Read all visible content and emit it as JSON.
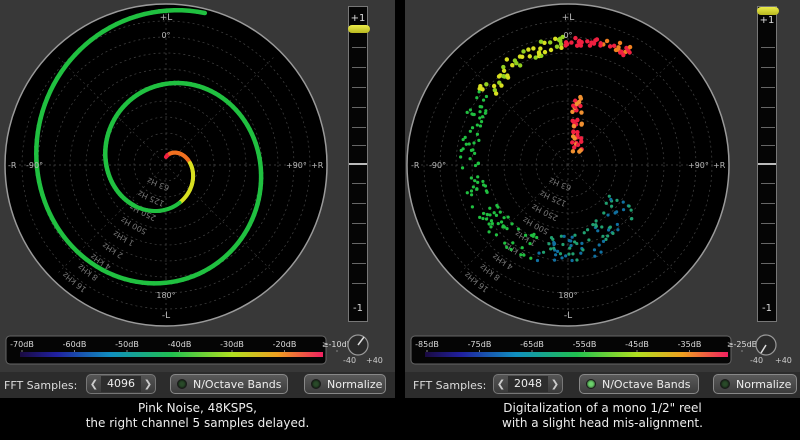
{
  "left": {
    "caption_line1": "Pink Noise, 48KSPS,",
    "caption_line2": "the right channel 5 samples delayed.",
    "scale_labels": [
      "-70dB",
      "-60dB",
      "-50dB",
      "-40dB",
      "-30dB",
      "-20dB",
      "≥-10dB"
    ],
    "fft_label": "FFT Samples:",
    "fft_value": "4096",
    "octave_label": "N/Octave Bands",
    "normalize_label": "Normalize",
    "octave_on": false,
    "normalize_on": false,
    "band_labels": [
      "63 Hz",
      "125 Hz",
      "250 Hz",
      "500 Hz",
      "1 kHz",
      "2 kHz",
      "4 kHz",
      "8 kHz",
      "16 kHz"
    ]
  },
  "right": {
    "caption_line1": "Digitalization of a mono 1/2\" reel",
    "caption_line2": "with a slight head mis-alignment.",
    "scale_labels": [
      "-85dB",
      "-75dB",
      "-65dB",
      "-55dB",
      "-45dB",
      "-35dB",
      "≥-25dB"
    ],
    "fft_label": "FFT Samples:",
    "fft_value": "2048",
    "octave_label": "N/Octave Bands",
    "normalize_label": "Normalize",
    "octave_on": true,
    "normalize_on": false,
    "band_labels": [
      "63 Hz",
      "125 Hz",
      "250 Hz",
      "500 Hz",
      "1 kHz",
      "2 kHz",
      "4 kHz",
      "8 kHz",
      "16 kHz"
    ]
  },
  "scope": {
    "top_label": "+L",
    "top_angle": "0°",
    "bottom_label": "-L",
    "bottom_angle": "180°",
    "left_label": "-R",
    "left_angle": "-90°",
    "right_label": "+R",
    "right_angle": "+90°"
  },
  "meter": {
    "top_label": "+1",
    "bottom_label": "-1",
    "knob_min": "-40",
    "knob_max": "+40"
  },
  "colors": {
    "panel": "#383838",
    "scope_bg": "#000000",
    "trace_green": "#20c040",
    "trace_yellow": "#d8e020",
    "trace_red": "#f02040",
    "meter_indicator": "#d8d830"
  },
  "icons": {
    "prev": "chevron-left-icon",
    "next": "chevron-right-icon",
    "led": "led-indicator-icon",
    "knob": "rotary-knob-icon"
  }
}
